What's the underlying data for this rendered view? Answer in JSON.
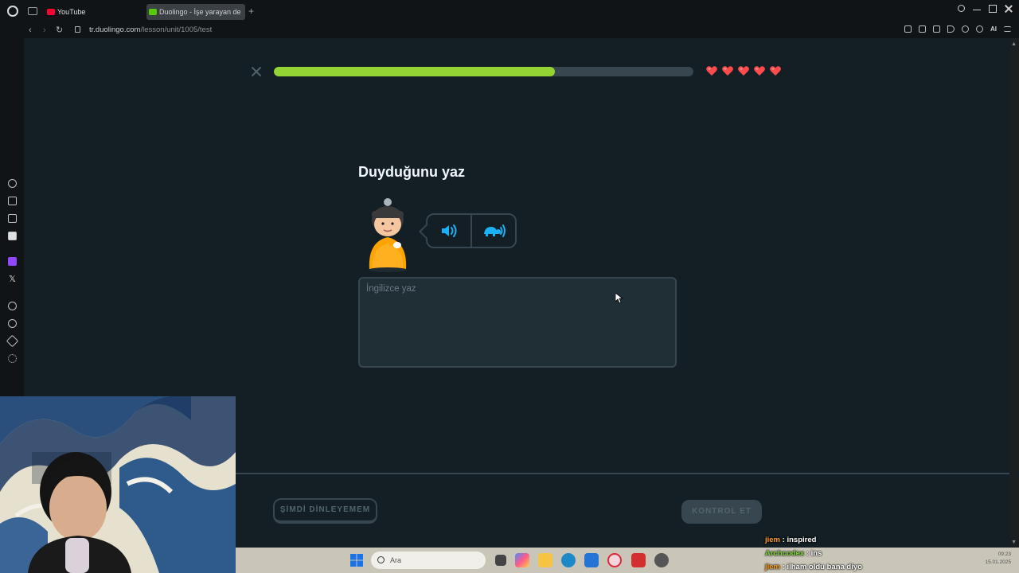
{
  "browser": {
    "tabs": [
      {
        "label": "YouTube"
      },
      {
        "label": "Duolingo - İşe yarayan de"
      }
    ],
    "url_host": "tr.duolingo.com",
    "url_path": "/lesson/unit/1005/test",
    "ai_label": "AI"
  },
  "lesson": {
    "progress": 0.67,
    "hearts": 5,
    "prompt_title": "Duyduğunu yaz",
    "answer_placeholder": "İngilizce yaz",
    "answer_value": "",
    "cant_listen_label": "ŞİMDİ DİNLEYEMEM",
    "check_label": "KONTROL ET"
  },
  "taskbar": {
    "search_placeholder": "Ara",
    "time": "09:23",
    "date": "15.01.2025"
  },
  "chat": [
    {
      "user": "jiem",
      "message": "inspired"
    },
    {
      "user": "Archcodex",
      "message": "ins"
    },
    {
      "user": "jiem",
      "message": "ilham oldu bana diyo"
    }
  ],
  "colors": {
    "progress_fill": "#93d333",
    "heart": "#ff4b4b",
    "audio_icon": "#1cb0f6",
    "page_bg": "#131f24"
  }
}
